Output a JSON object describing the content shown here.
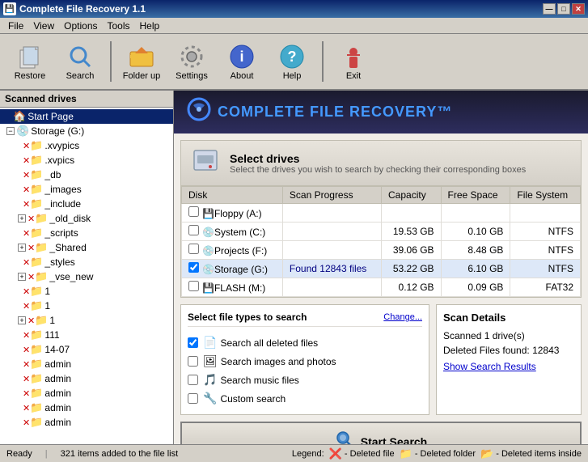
{
  "titlebar": {
    "title": "Complete File Recovery 1.1",
    "icon": "💾",
    "minimize": "—",
    "maximize": "□",
    "close": "✕"
  },
  "menubar": {
    "items": [
      "File",
      "View",
      "Options",
      "Tools",
      "Help"
    ]
  },
  "toolbar": {
    "buttons": [
      {
        "id": "restore",
        "label": "Restore",
        "icon": "📄"
      },
      {
        "id": "search",
        "label": "Search",
        "icon": "🔍"
      },
      {
        "id": "folder-up",
        "label": "Folder up",
        "icon": "📁"
      },
      {
        "id": "settings",
        "label": "Settings",
        "icon": "⚙"
      },
      {
        "id": "about",
        "label": "About",
        "icon": "ℹ"
      },
      {
        "id": "help",
        "label": "Help",
        "icon": "❓"
      },
      {
        "id": "exit",
        "label": "Exit",
        "icon": "🚶"
      }
    ]
  },
  "sidebar": {
    "header": "Scanned drives",
    "tree": [
      {
        "id": "start-page",
        "label": "Start Page",
        "level": 1,
        "selected": true,
        "icon": "🏠",
        "expandable": false
      },
      {
        "id": "storage-g",
        "label": "Storage (G:)",
        "level": 2,
        "icon": "💾",
        "expandable": true
      },
      {
        "id": "xvypics",
        "label": ".xvypics",
        "level": 3,
        "icon": "📁"
      },
      {
        "id": "xvpics",
        "label": ".xvpics",
        "level": 3,
        "icon": "📁"
      },
      {
        "id": "db",
        "label": "_db",
        "level": 3,
        "icon": "📁"
      },
      {
        "id": "images",
        "label": "_images",
        "level": 3,
        "icon": "📁"
      },
      {
        "id": "include",
        "label": "_include",
        "level": 3,
        "icon": "📁"
      },
      {
        "id": "old-disk",
        "label": "_old_disk",
        "level": 3,
        "icon": "📁",
        "expandable": true
      },
      {
        "id": "scripts",
        "label": "_scripts",
        "level": 3,
        "icon": "📁"
      },
      {
        "id": "shared",
        "label": "_Shared",
        "level": 3,
        "icon": "📁",
        "expandable": true
      },
      {
        "id": "styles",
        "label": "_styles",
        "level": 3,
        "icon": "📁"
      },
      {
        "id": "vse-new",
        "label": "_vse_new",
        "level": 3,
        "icon": "📁",
        "expandable": true
      },
      {
        "id": "item1a",
        "label": "1",
        "level": 3,
        "icon": "📁"
      },
      {
        "id": "item1b",
        "label": "1",
        "level": 3,
        "icon": "📁"
      },
      {
        "id": "item1c",
        "label": "1",
        "level": 3,
        "icon": "📁",
        "expandable": true
      },
      {
        "id": "item111",
        "label": "111",
        "level": 3,
        "icon": "📁"
      },
      {
        "id": "item14-07",
        "label": "14-07",
        "level": 3,
        "icon": "📁"
      },
      {
        "id": "admin1",
        "label": "admin",
        "level": 3,
        "icon": "📁"
      },
      {
        "id": "admin2",
        "label": "admin",
        "level": 3,
        "icon": "📁"
      },
      {
        "id": "admin3",
        "label": "admin",
        "level": 3,
        "icon": "📁"
      },
      {
        "id": "admin4",
        "label": "admin",
        "level": 3,
        "icon": "📁"
      },
      {
        "id": "admin5",
        "label": "admin",
        "level": 3,
        "icon": "📁"
      }
    ]
  },
  "banner": {
    "logo_text": "COMPLETE FILE RECOVERY™",
    "logo_icon": "🔄"
  },
  "drives": {
    "title": "Select drives",
    "subtitle": "Select the drives you wish to search by checking their corresponding boxes",
    "columns": [
      "Disk",
      "Scan Progress",
      "Capacity",
      "Free Space",
      "File System"
    ],
    "rows": [
      {
        "name": "Floppy (A:)",
        "scan_progress": "",
        "capacity": "",
        "free_space": "",
        "fs": "",
        "checked": false,
        "icon": "💾"
      },
      {
        "name": "System (C:)",
        "scan_progress": "",
        "capacity": "19.53 GB",
        "free_space": "0.10 GB",
        "fs": "NTFS",
        "checked": false,
        "icon": "💿"
      },
      {
        "name": "Projects (F:)",
        "scan_progress": "",
        "capacity": "39.06 GB",
        "free_space": "8.48 GB",
        "fs": "NTFS",
        "checked": false,
        "icon": "💿"
      },
      {
        "name": "Storage (G:)",
        "scan_progress": "Found 12843 files",
        "capacity": "53.22 GB",
        "free_space": "6.10 GB",
        "fs": "NTFS",
        "checked": true,
        "icon": "💿"
      },
      {
        "name": "FLASH (M:)",
        "scan_progress": "",
        "capacity": "0.12 GB",
        "free_space": "0.09 GB",
        "fs": "FAT32",
        "checked": false,
        "icon": "💾"
      }
    ]
  },
  "filetypes": {
    "title": "Select file types to search",
    "change_label": "Change...",
    "items": [
      {
        "label": "Search all deleted files",
        "checked": true,
        "icon": "📄"
      },
      {
        "label": "Search images and photos",
        "checked": false,
        "icon": "🖼"
      },
      {
        "label": "Search music files",
        "checked": false,
        "icon": "🎵"
      },
      {
        "label": "Custom search",
        "checked": false,
        "icon": "🔧"
      }
    ]
  },
  "scan_details": {
    "title": "Scan Details",
    "scanned": "Scanned 1 drive(s)",
    "deleted": "Deleted Files found: 12843",
    "show_results_label": "Show Search Results"
  },
  "start_search": {
    "label": "Start Search",
    "icon": "🔍"
  },
  "statusbar": {
    "status": "Ready",
    "items_added": "321 items added to the file list",
    "legend_label": "Legend:",
    "legend_items": [
      {
        "icon": "❌",
        "label": "- Deleted file"
      },
      {
        "icon": "📁",
        "label": "- Deleted folder"
      },
      {
        "icon": "📂",
        "label": "- Deleted items inside"
      }
    ]
  }
}
